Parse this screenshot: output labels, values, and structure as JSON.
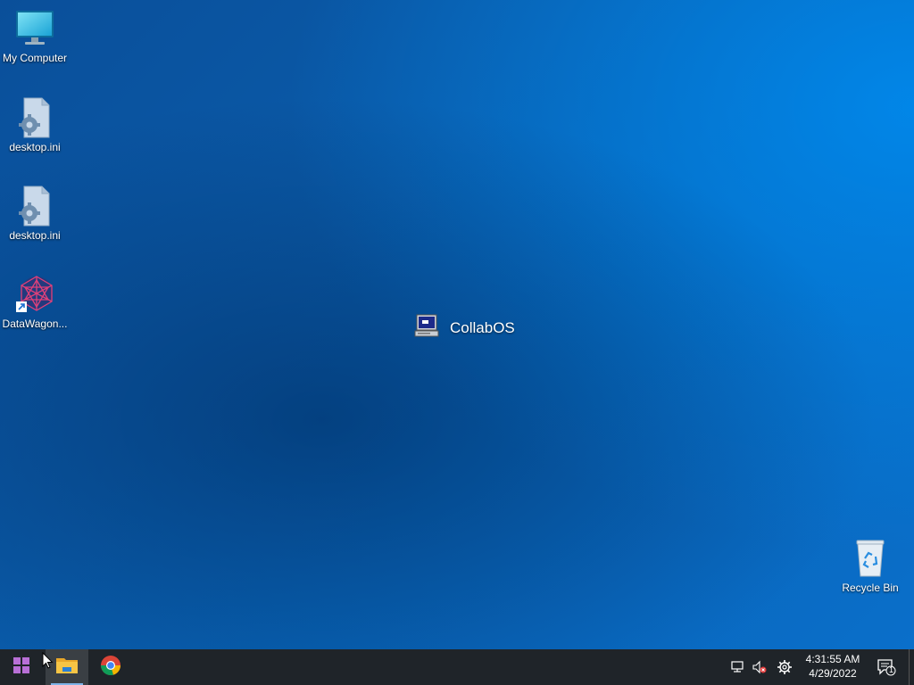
{
  "desktop": {
    "icons": [
      {
        "label": "My Computer",
        "icon": "monitor-icon"
      },
      {
        "label": "desktop.ini",
        "icon": "settings-file-icon"
      },
      {
        "label": "desktop.ini",
        "icon": "settings-file-icon"
      },
      {
        "label": "DataWagon...",
        "icon": "datawagon-shortcut-icon"
      },
      {
        "label": "Recycle Bin",
        "icon": "recycle-bin-icon"
      }
    ],
    "center_label": "CollabOS"
  },
  "taskbar": {
    "pinned": [
      {
        "name": "Start",
        "icon": "windows-logo-icon"
      },
      {
        "name": "File Explorer",
        "icon": "folder-icon"
      },
      {
        "name": "Google Chrome",
        "icon": "chrome-icon"
      }
    ],
    "tray": {
      "icons": [
        "network-icon",
        "volume-muted-icon",
        "gear-icon"
      ],
      "time": "4:31:55 AM",
      "date": "4/29/2022",
      "notification_count": "1"
    }
  },
  "colors": {
    "taskbar_bg": "#1f2429",
    "desktop_blue": "#0a5aa8",
    "start_purple": "#b86fd6"
  }
}
